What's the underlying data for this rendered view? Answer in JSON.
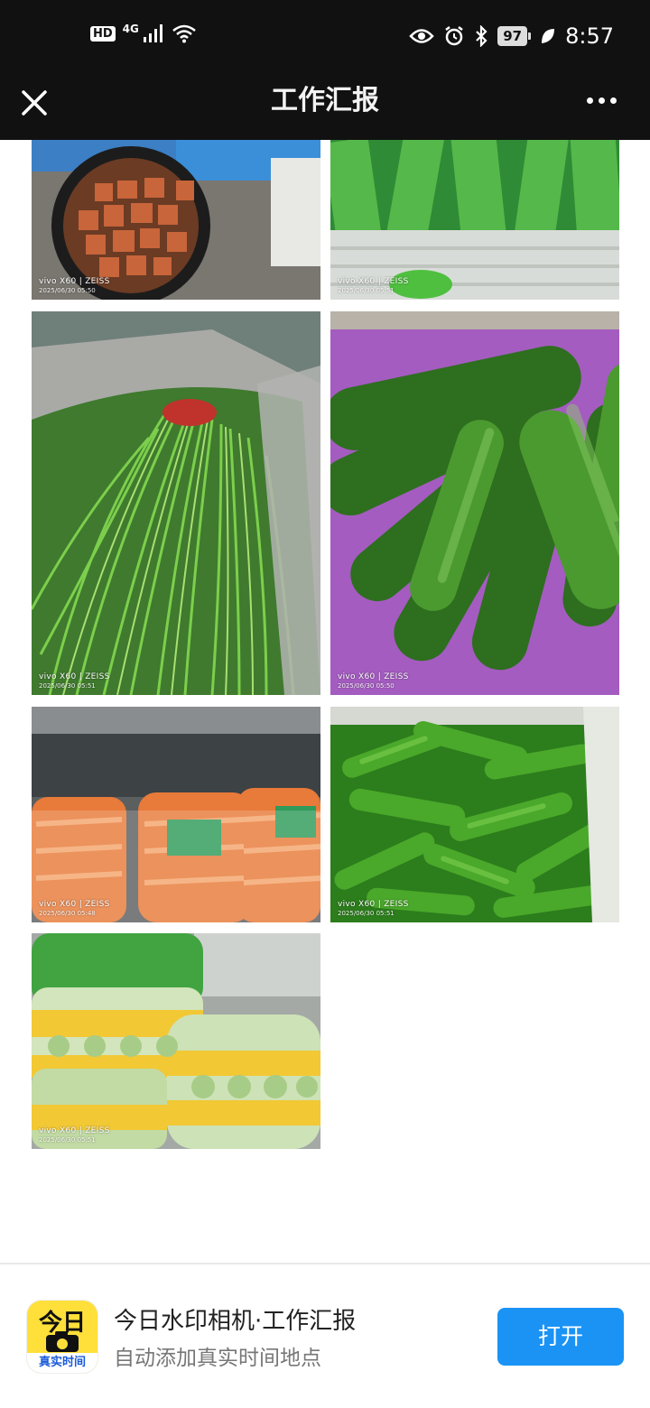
{
  "status_bar": {
    "left_badge": "HD",
    "network": "4G",
    "battery": "97",
    "time": "8:57"
  },
  "header": {
    "title": "工作汇报"
  },
  "photos": [
    {
      "camera": "vivo X60 | ZEISS",
      "timestamp": "2025/06/30 05:50",
      "subject": "braised-meat-pot"
    },
    {
      "camera": "vivo X60 | ZEISS",
      "timestamp": "2025/06/30 05:51",
      "subject": "green-vegetables-crate"
    },
    {
      "camera": "vivo X60 | ZEISS",
      "timestamp": "2025/06/30 05:51",
      "subject": "chives-bag"
    },
    {
      "camera": "vivo X60 | ZEISS",
      "timestamp": "2025/06/30 05:50",
      "subject": "cucumbers"
    },
    {
      "camera": "vivo X60 | ZEISS",
      "timestamp": "2025/06/30 05:48",
      "subject": "carrot-bags"
    },
    {
      "camera": "vivo X60 | ZEISS",
      "timestamp": "2025/06/30 05:51",
      "subject": "green-peppers"
    },
    {
      "camera": "vivo X60 | ZEISS",
      "timestamp": "2025/06/30 05:51",
      "subject": "cabbage-bags"
    }
  ],
  "banner": {
    "icon_top": "今日",
    "icon_bottom": "真实时间",
    "app_name": "今日水印相机·工作汇报",
    "app_desc": "自动添加真实时间地点",
    "open_label": "打开"
  },
  "colors": {
    "topbar": "#111111",
    "open_button": "#1a93f5",
    "app_icon": "#ffe03a"
  }
}
